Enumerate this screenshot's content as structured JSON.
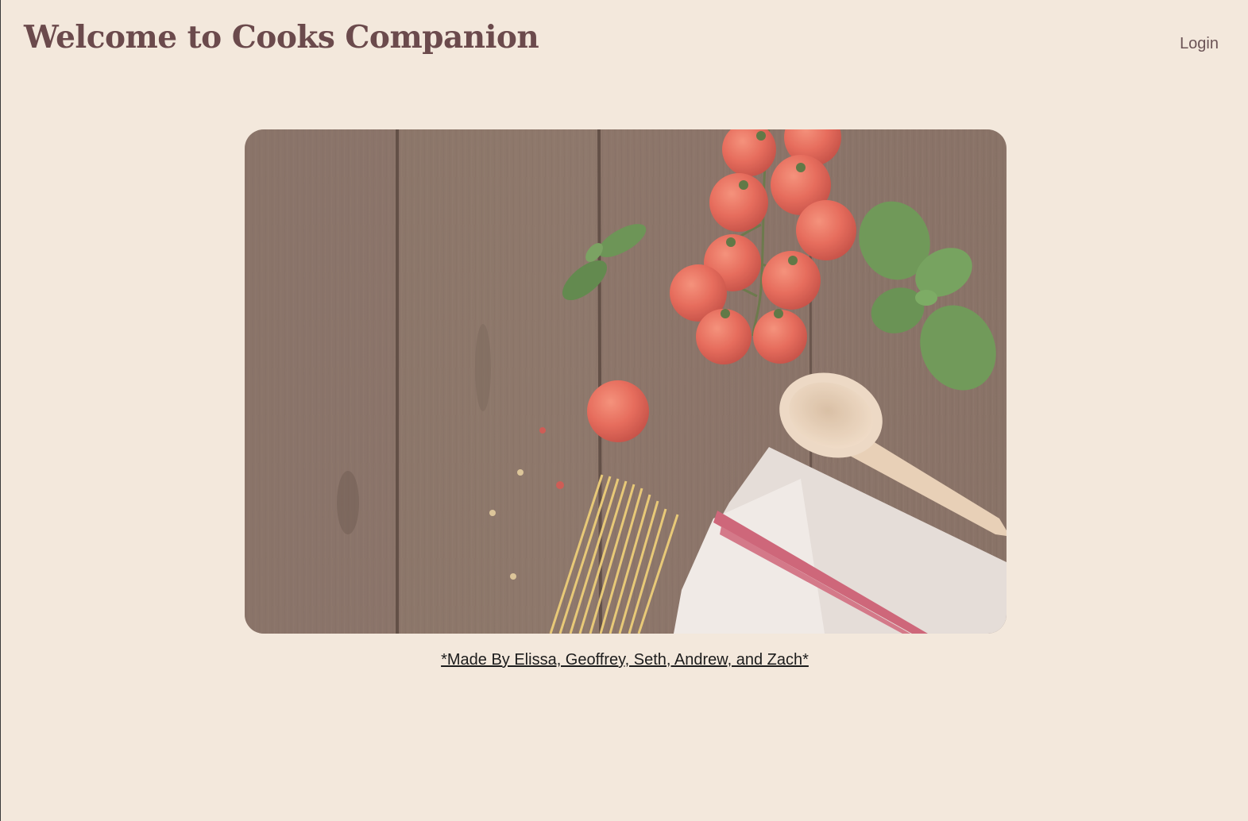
{
  "header": {
    "title": "Welcome to Cooks Companion",
    "login_label": "Login"
  },
  "hero": {
    "alt": "Cooking ingredients: cherry tomatoes, basil, spaghetti, wooden spoon and kitchen towel on a wooden table"
  },
  "footer": {
    "credits": "*Made By Elissa, Geoffrey, Seth, Andrew, and Zach*"
  },
  "colors": {
    "background": "#f3e8dc",
    "title": "#6b4a4c",
    "login": "#6b5456",
    "credits": "#1c1c1c"
  }
}
